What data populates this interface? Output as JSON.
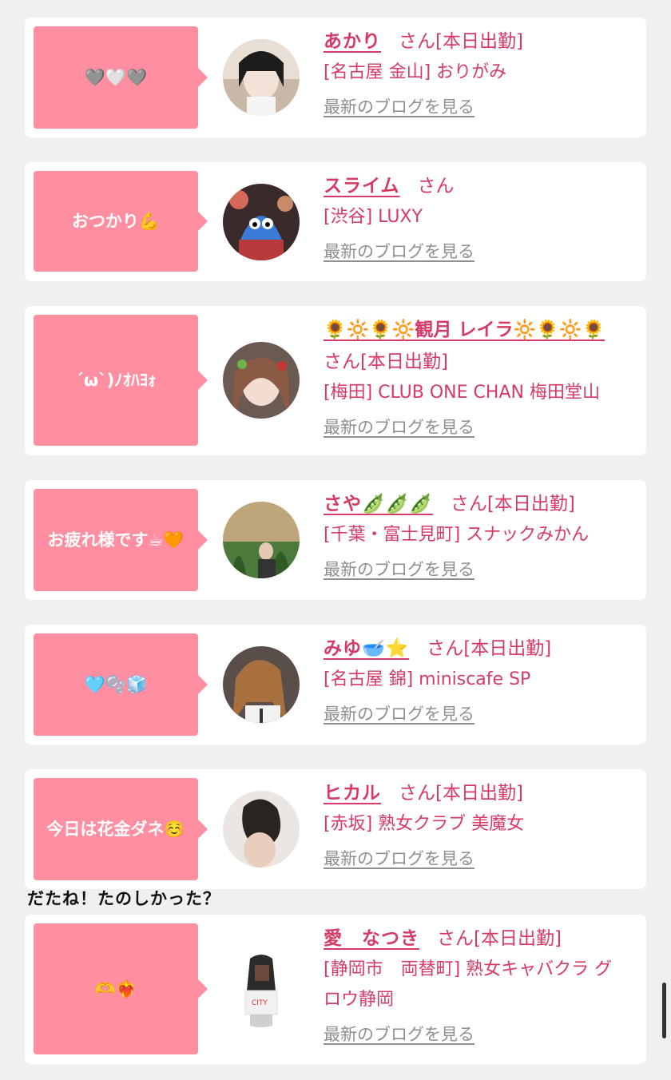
{
  "entries": [
    {
      "message": "🩶🤍🩶",
      "name": "あかり",
      "san": "さん",
      "today": "[本日出勤]",
      "shop": "[名古屋 金山] おりがみ",
      "blog": "最新のブログを見る"
    },
    {
      "message": "おつかり💪",
      "name": "スライム",
      "san": "さん",
      "today": "",
      "shop": "[渋谷] LUXY",
      "blog": "最新のブログを見る"
    },
    {
      "message": "´ω`)ﾉｵﾊﾖｫ",
      "name": "🌻🔆🌻🔆観月 レイラ🔆🌻🔆🌻",
      "san": "さん",
      "today": "[本日出勤]",
      "shop": "[梅田] CLUB ONE CHAN 梅田堂山",
      "blog": "最新のブログを見る"
    },
    {
      "message": "お疲れ様です☕🧡",
      "name": "さや🫛🫛🫛",
      "san": "さん",
      "today": "[本日出勤]",
      "shop": "[千葉・富士見町] スナックみかん",
      "blog": "最新のブログを見る"
    },
    {
      "message": "🩵🫧🧊",
      "name": "みゆ🥣⭐",
      "san": "さん",
      "today": "[本日出勤]",
      "shop": "[名古屋 錦] miniscafe SP",
      "blog": "最新のブログを見る"
    },
    {
      "message": "今日は花金ダネ☺️",
      "name": "ヒカル",
      "san": "さん",
      "today": "[本日出勤]",
      "shop": "[赤坂] 熟女クラブ 美魔女",
      "blog": "最新のブログを見る"
    },
    {
      "message": "🫶❤️‍🔥",
      "name": "愛　なつき",
      "san": "さん",
      "today": "[本日出勤]",
      "shop": "[静岡市　両替町] 熟女キャバクラ グロウ静岡",
      "blog": "最新のブログを見る"
    }
  ],
  "note": "だたね！たのしかった？",
  "colors": {
    "accent": "#d63a67",
    "bubble": "#ff8fa0",
    "link_gray": "#8f8f8f",
    "background": "#f0f0f0"
  }
}
